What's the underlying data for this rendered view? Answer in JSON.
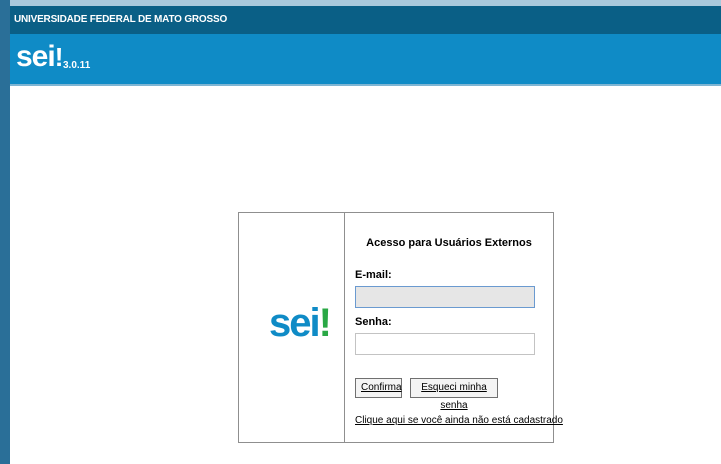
{
  "header": {
    "organization": "UNIVERSIDADE FEDERAL DE MATO GROSSO",
    "logo_text": "sei",
    "logo_mark": "!",
    "version": "3.0.11"
  },
  "login": {
    "logo_text": "sei",
    "logo_mark": "!",
    "title": "Acesso para Usuários Externos",
    "email_label": "E-mail:",
    "email_value": "",
    "password_label": "Senha:",
    "password_value": "",
    "confirm_button": "Confirma",
    "forgot_button": "Esqueci minha senha",
    "register_link": "Clique aqui se você ainda não está cadastrado"
  },
  "colors": {
    "header_blue": "#0f8bc6",
    "org_bar": "#0a5f86",
    "logo_green": "#2aa845"
  }
}
